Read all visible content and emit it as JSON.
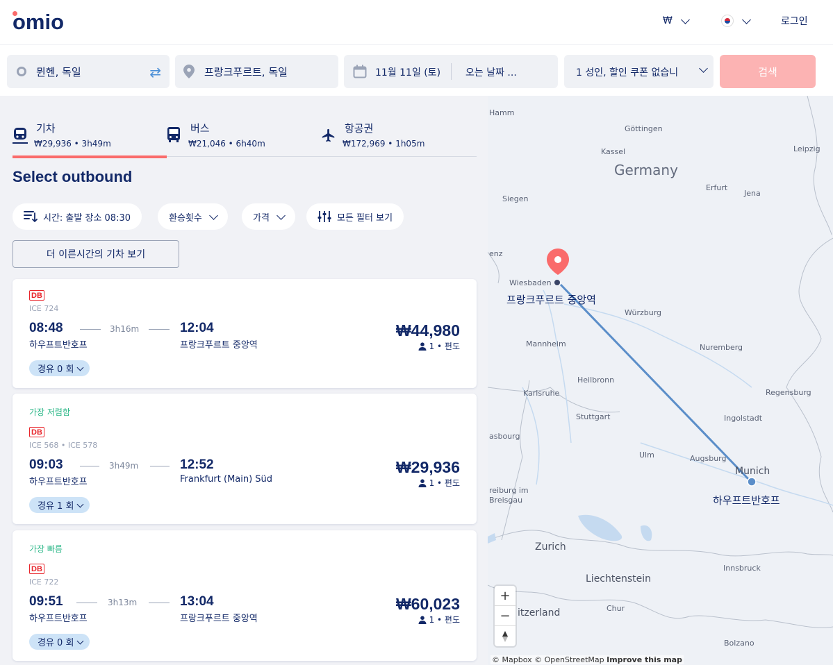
{
  "header": {
    "logo": "omio",
    "currency": "₩",
    "login": "로그인",
    "accent_color": "#fa6b6b"
  },
  "search": {
    "origin": "뮌헨, 독일",
    "destination": "프랑크푸르트, 독일",
    "depart_date": "11월 11일 (토)",
    "return_placeholder": "오는 날짜 ...",
    "passengers": "1 성인, 할인 쿠폰 없습니",
    "search_button": "검색"
  },
  "tabs": [
    {
      "label": "기차",
      "summary": "₩29,936 • 3h49m",
      "icon": "train-icon"
    },
    {
      "label": "버스",
      "summary": "₩21,046 • 6h40m",
      "icon": "bus-icon"
    },
    {
      "label": "항공권",
      "summary": "₩172,969 • 1h05m",
      "icon": "plane-icon"
    }
  ],
  "page_title": "Select outbound",
  "filters": {
    "sort": "시간: 출발 장소 08:30",
    "transfers": "환승횟수",
    "price": "가격",
    "all_filters": "모든 필터 보기"
  },
  "earlier_button": "더 이른시간의 기차 보기",
  "results": [
    {
      "badge": "",
      "operator": "DB",
      "train": "ICE 724",
      "depart": "08:48",
      "duration": "3h16m",
      "arrive": "12:04",
      "from": "하우프트반호프",
      "to": "프랑크푸르트 중앙역",
      "price": "₩44,980",
      "pax": "1 • 편도",
      "stops": "경유 0 회"
    },
    {
      "badge": "가장 저렴함",
      "operator": "DB",
      "train": "ICE 568 • ICE 578",
      "depart": "09:03",
      "duration": "3h49m",
      "arrive": "12:52",
      "from": "하우프트반호프",
      "to": "Frankfurt (Main) Süd",
      "price": "₩29,936",
      "pax": "1 • 편도",
      "stops": "경유 1 회"
    },
    {
      "badge": "가장 빠름",
      "operator": "DB",
      "train": "ICE 722",
      "depart": "09:51",
      "duration": "3h13m",
      "arrive": "13:04",
      "from": "하우프트반호프",
      "to": "프랑크푸르트 중앙역",
      "price": "₩60,023",
      "pax": "1 • 편도",
      "stops": "경유 0 회"
    }
  ],
  "map": {
    "labels": {
      "hamm": "Hamm",
      "goettingen": "Göttingen",
      "leipzig": "Leipzig",
      "kassel": "Kassel",
      "germany": "Germany",
      "erfurt": "Erfurt",
      "jena": "Jena",
      "siegen": "Siegen",
      "enz": "enz",
      "wiesbaden": "Wiesbaden",
      "wuerzburg": "Würzburg",
      "mannheim": "Mannheim",
      "nuremberg": "Nuremberg",
      "heilbronn": "Heilbronn",
      "regensburg": "Regensburg",
      "karlsruhe": "Karlsruhe",
      "stuttgart": "Stuttgart",
      "ingolstadt": "Ingolstadt",
      "asbourg": "asbourg",
      "ulm": "Ulm",
      "augsburg": "Augsburg",
      "munich": "Munich",
      "freiburg": "reiburg im\nBreisgau",
      "zurich": "Zurich",
      "liechtenstein": "Liechtenstein",
      "innsbruck": "Innsbruck",
      "switzerland": "itzerland",
      "chur": "Chur",
      "bolzano": "Bolzano"
    },
    "destination_station": "프랑크푸르트 중앙역",
    "origin_station": "하우프트반호프",
    "zoom_in": "+",
    "zoom_out": "−",
    "attribution_mapbox": "© Mapbox © OpenStreetMap",
    "attribution_improve": "Improve this map",
    "route_color": "#5b8ec9"
  }
}
